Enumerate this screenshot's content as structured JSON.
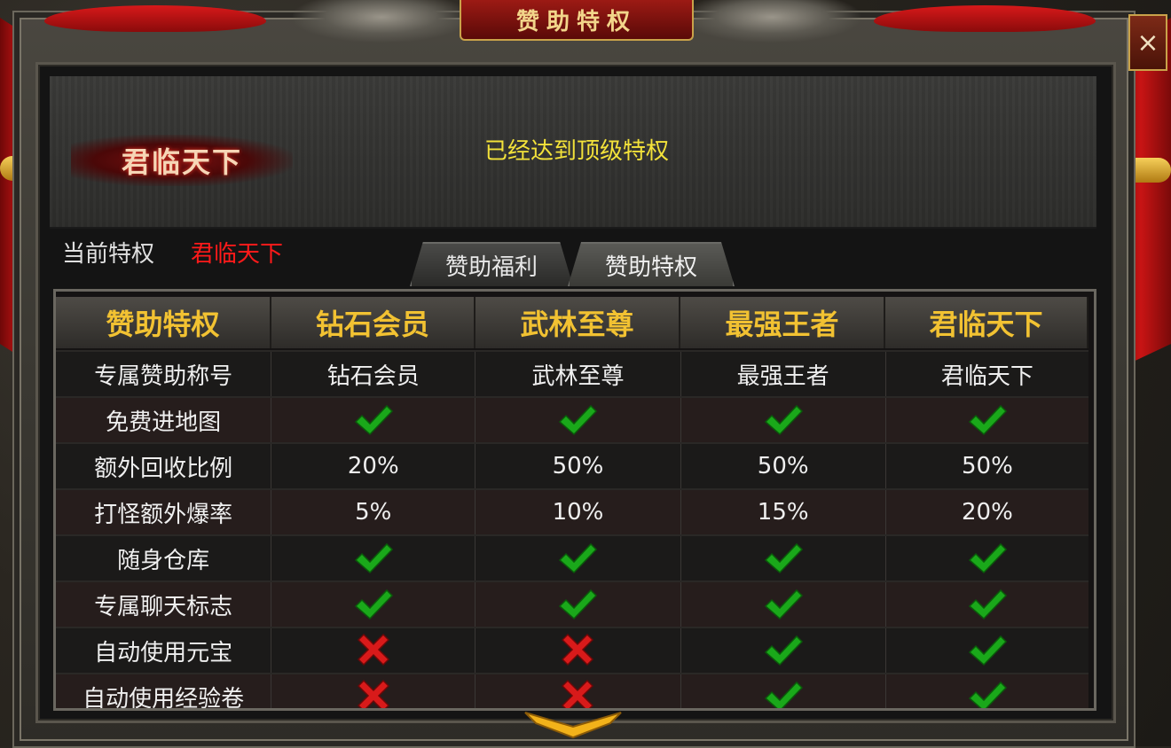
{
  "window": {
    "title": "赞助特权",
    "close_label": "×"
  },
  "header": {
    "level_name": "君临天下",
    "status": "已经达到顶级特权"
  },
  "current": {
    "label": "当前特权",
    "value": "君临天下"
  },
  "tabs": [
    {
      "label": "赞助福利",
      "active": false
    },
    {
      "label": "赞助特权",
      "active": true
    }
  ],
  "table": {
    "columns": [
      "赞助特权",
      "钻石会员",
      "武林至尊",
      "最强王者",
      "君临天下"
    ],
    "rows": [
      {
        "label": "专属赞助称号",
        "values": [
          "钻石会员",
          "武林至尊",
          "最强王者",
          "君临天下"
        ]
      },
      {
        "label": "免费进地图",
        "values": [
          "check",
          "check",
          "check",
          "check"
        ]
      },
      {
        "label": "额外回收比例",
        "values": [
          "20%",
          "50%",
          "50%",
          "50%"
        ]
      },
      {
        "label": "打怪额外爆率",
        "values": [
          "5%",
          "10%",
          "15%",
          "20%"
        ]
      },
      {
        "label": "随身仓库",
        "values": [
          "check",
          "check",
          "check",
          "check"
        ]
      },
      {
        "label": "专属聊天标志",
        "values": [
          "check",
          "check",
          "check",
          "check"
        ]
      },
      {
        "label": "自动使用元宝",
        "values": [
          "cross",
          "cross",
          "check",
          "check"
        ]
      },
      {
        "label": "自动使用经验卷",
        "values": [
          "cross",
          "cross",
          "check",
          "check"
        ]
      }
    ]
  },
  "icons": {
    "check": "check-icon",
    "cross": "cross-icon",
    "scroll": "chevron-down-icon",
    "close": "close-icon"
  },
  "colors": {
    "accent_gold": "#f2c232",
    "status_yellow": "#f3e23a",
    "current_red": "#ff1a1a",
    "check_green": "#1aa81a",
    "cross_red": "#d81a1a"
  }
}
